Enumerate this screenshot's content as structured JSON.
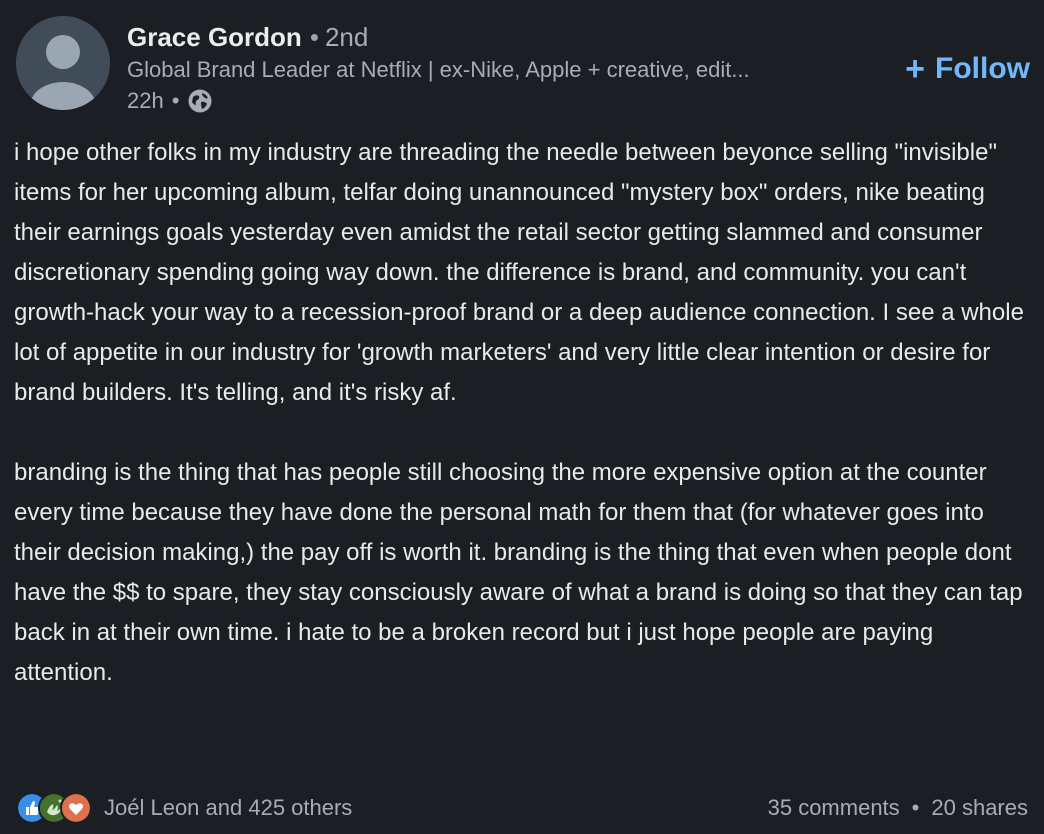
{
  "post": {
    "author": {
      "name": "Grace Gordon",
      "degree": "2nd",
      "headline": "Global Brand Leader at Netflix | ex-Nike, Apple + creative, edit...",
      "time": "22h",
      "visibility_icon": "globe-icon"
    },
    "follow": {
      "icon": "plus-icon",
      "plus_glyph": "+",
      "label": "Follow"
    },
    "paragraphs": [
      "i hope other folks in my industry are threading the needle between beyonce selling \"invisible\" items for her upcoming album, telfar doing unannounced \"mystery box\" orders, nike beating their earnings goals yesterday even amidst the retail sector getting slammed and consumer discretionary spending going way down. the difference is brand, and community. you can't growth-hack your way to a recession-proof brand or a deep audience connection. I see a whole lot of appetite in our industry for 'growth marketers' and very little clear intention or desire for brand builders. It's telling, and it's risky af.",
      "branding is the thing that has people still choosing the more expensive option at the counter every time because they have done the personal math for them that (for whatever goes into their decision making,) the pay off is worth it. branding is the thing that even when people dont have the $$ to spare, they stay consciously aware of what a brand is doing so that they can tap back in at their own time. i hate to be a broken record but i just hope people are paying attention."
    ],
    "social": {
      "reactions": [
        "like-icon",
        "celebrate-icon",
        "love-icon"
      ],
      "reactions_text": "Joél Leon and 425 others",
      "comments": "35 comments",
      "shares": "20 shares"
    }
  },
  "colors": {
    "background": "#1b1f23",
    "text": "#e9e9e9",
    "muted": "#a6adb4",
    "accent": "#71b7fb"
  }
}
